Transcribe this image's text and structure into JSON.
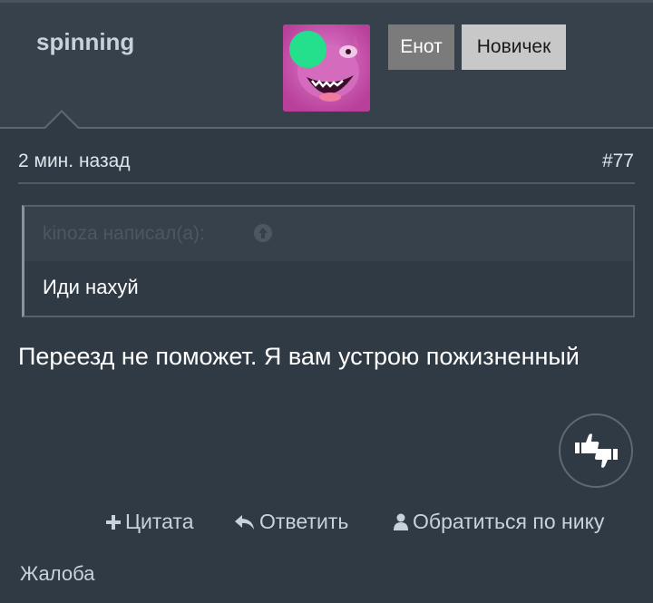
{
  "post": {
    "username": "spinning",
    "avatar_icon": "troll-face-avatar",
    "online_color": "#24e08c",
    "badges": [
      "Енот",
      "Новичек"
    ],
    "time": "2 мин. назад",
    "number": "#77",
    "quote": {
      "author": "kinoza написал(а):",
      "author_icon": "arrow-up-circle-icon",
      "text": "Иди нахуй"
    },
    "body": "Переезд не поможет. Я вам устрою пожизненный",
    "rate_icon": "thumbs-up-down-icon"
  },
  "actions": {
    "quote": "Цитата",
    "reply": "Ответить",
    "nick": "Обратиться по нику",
    "complaint": "Жалоба"
  }
}
